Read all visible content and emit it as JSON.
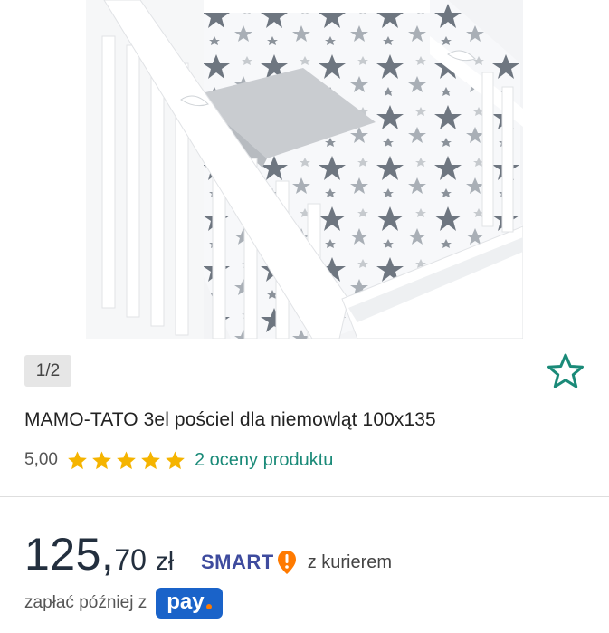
{
  "gallery": {
    "counter": "1/2",
    "image_alt": "Crib with star-patterned bedding set"
  },
  "product": {
    "title": "MAMO-TATO 3el pościel dla niemowląt 100x135",
    "rating_value": "5,00",
    "rating_stars": 5,
    "reviews_link": "2 oceny produktu"
  },
  "price": {
    "integer": "125,",
    "decimal": "70",
    "currency": "zł"
  },
  "delivery": {
    "smart_label": "SMART",
    "courier_text": "z kurierem"
  },
  "payment": {
    "later_text": "zapłać później z",
    "pay_label": "pay"
  },
  "colors": {
    "star_rating": "#f5b400",
    "accent_teal": "#1a8a78",
    "price_text": "#232f3e",
    "smart_blue": "#3e4b9e",
    "smart_orange": "#ff7a00",
    "pay_blue": "#1a63c9"
  },
  "icons": {
    "favorite": "star-outline-icon",
    "rating": "star-filled-icon",
    "smart_badge": "exclamation-shield-icon"
  }
}
